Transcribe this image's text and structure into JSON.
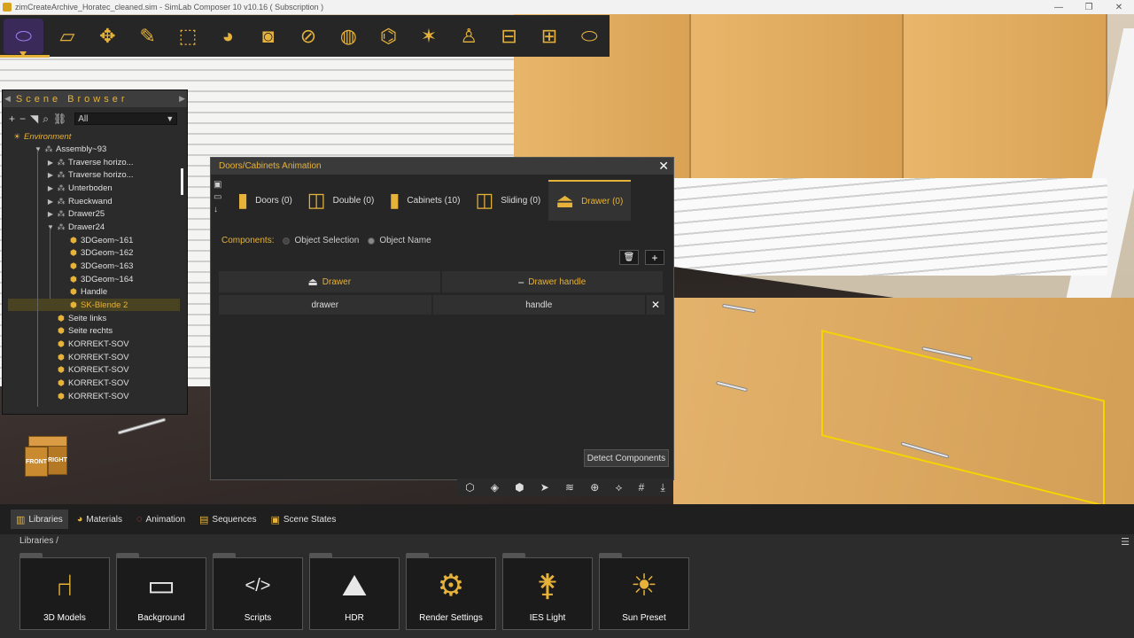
{
  "window": {
    "title": "zimCreateArchive_Horatec_cleaned.sim - SimLab Composer 10 v10.16 ( Subscription )",
    "controls": {
      "minimize": "—",
      "restore": "❐",
      "close": "✕"
    }
  },
  "main_toolbar": {
    "icons": [
      "vr-headset-icon",
      "folder-icon",
      "move-icon",
      "edit-icon",
      "selection-icon",
      "materials-icon",
      "camera-icon",
      "slash-icon",
      "globe-icon",
      "360-icon",
      "magic-icon",
      "light-icon",
      "layout-icon",
      "grid-icon",
      "vr-icon"
    ]
  },
  "scene_browser": {
    "title": "Scene Browser",
    "filter_value": "All",
    "tree": [
      {
        "label": "Environment",
        "level": 0,
        "type": "env",
        "expander": ""
      },
      {
        "label": "Assembly~93",
        "level": 1,
        "type": "assembly",
        "expander": "▼"
      },
      {
        "label": "Traverse horizo...",
        "level": 2,
        "type": "assembly",
        "expander": "▶"
      },
      {
        "label": "Traverse horizo...",
        "level": 2,
        "type": "assembly",
        "expander": "▶"
      },
      {
        "label": "Unterboden",
        "level": 2,
        "type": "assembly",
        "expander": "▶"
      },
      {
        "label": "Rueckwand",
        "level": 2,
        "type": "assembly",
        "expander": "▶"
      },
      {
        "label": "Drawer25",
        "level": 2,
        "type": "assembly",
        "expander": "▶"
      },
      {
        "label": "Drawer24",
        "level": 2,
        "type": "assembly",
        "expander": "▼"
      },
      {
        "label": "3DGeom~161",
        "level": 3,
        "type": "geom",
        "expander": ""
      },
      {
        "label": "3DGeom~162",
        "level": 3,
        "type": "geom",
        "expander": ""
      },
      {
        "label": "3DGeom~163",
        "level": 3,
        "type": "geom",
        "expander": ""
      },
      {
        "label": "3DGeom~164",
        "level": 3,
        "type": "geom",
        "expander": ""
      },
      {
        "label": "Handle",
        "level": 3,
        "type": "geom",
        "expander": ""
      },
      {
        "label": "SK-Blende 2",
        "level": 3,
        "type": "geom",
        "expander": "",
        "selected": true
      },
      {
        "label": "Seite links",
        "level": 2,
        "type": "geom",
        "expander": ""
      },
      {
        "label": "Seite rechts",
        "level": 2,
        "type": "geom",
        "expander": ""
      },
      {
        "label": "KORREKT-SOV",
        "level": 2,
        "type": "geom",
        "expander": ""
      },
      {
        "label": "KORREKT-SOV",
        "level": 2,
        "type": "geom",
        "expander": ""
      },
      {
        "label": "KORREKT-SOV",
        "level": 2,
        "type": "geom",
        "expander": ""
      },
      {
        "label": "KORREKT-SOV",
        "level": 2,
        "type": "geom",
        "expander": ""
      },
      {
        "label": "KORREKT-SOV",
        "level": 2,
        "type": "geom",
        "expander": ""
      }
    ]
  },
  "nav_cube": {
    "front": "FRONT",
    "right": "RIGHT"
  },
  "dialog": {
    "title": "Doors/Cabinets Animation",
    "tabs": [
      {
        "label": "Doors (0)",
        "icon": "door-icon"
      },
      {
        "label": "Double (0)",
        "icon": "double-door-icon"
      },
      {
        "label": "Cabinets (10)",
        "icon": "cabinet-icon"
      },
      {
        "label": "Sliding (0)",
        "icon": "sliding-door-icon"
      },
      {
        "label": "Drawer (0)",
        "icon": "drawer-icon",
        "active": true
      }
    ],
    "components_label": "Components:",
    "radio_object_selection": "Object Selection",
    "radio_object_name": "Object Name",
    "table": {
      "headers": [
        "Drawer",
        "Drawer handle"
      ],
      "rows": [
        [
          "drawer",
          "handle"
        ]
      ]
    },
    "detect_button": "Detect Components"
  },
  "bottom_panel": {
    "tabs": [
      {
        "label": "Libraries",
        "active": true
      },
      {
        "label": "Materials"
      },
      {
        "label": "Animation"
      },
      {
        "label": "Sequences"
      },
      {
        "label": "Scene States"
      }
    ],
    "breadcrumb": "Libraries  /",
    "libraries": [
      {
        "label": "3D Models",
        "icon": "chair-icon"
      },
      {
        "label": "Background",
        "icon": "background-icon"
      },
      {
        "label": "Scripts",
        "icon": "script-icon"
      },
      {
        "label": "HDR",
        "icon": "hdr-icon"
      },
      {
        "label": "Render Settings",
        "icon": "render-settings-icon"
      },
      {
        "label": "IES Light",
        "icon": "ies-light-icon"
      },
      {
        "label": "Sun Preset",
        "icon": "sun-preset-icon"
      }
    ]
  },
  "colors": {
    "accent": "#e6b23a",
    "panel": "#262626",
    "selection": "#f5d400"
  }
}
